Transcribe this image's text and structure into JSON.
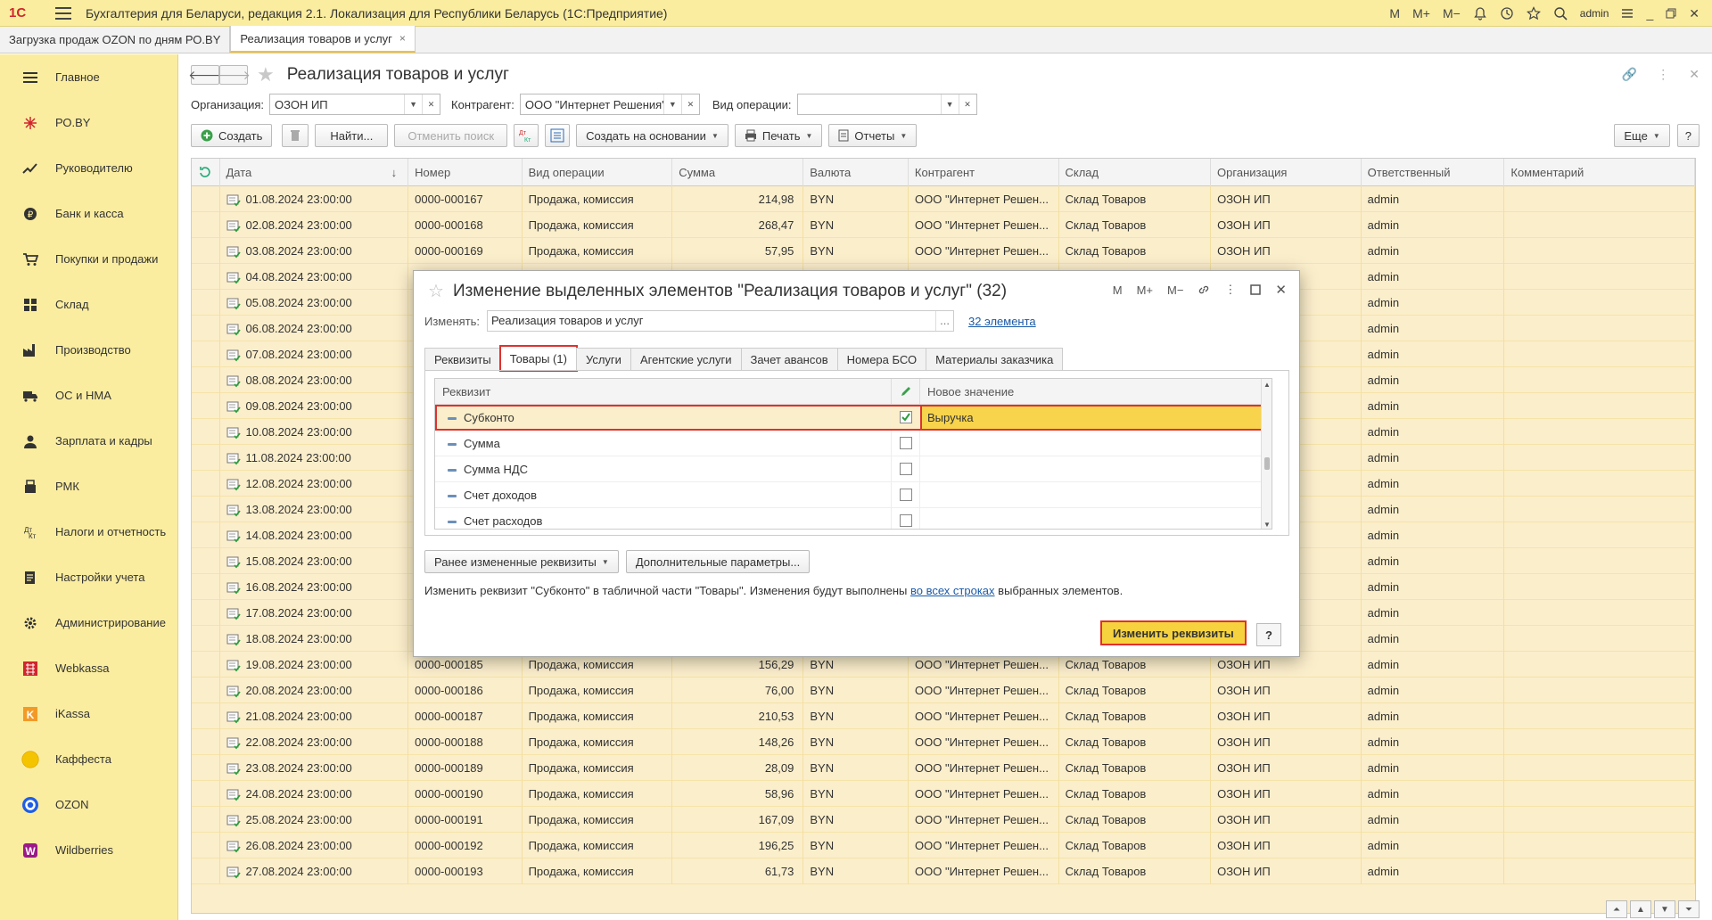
{
  "app": {
    "logo": "1С",
    "title": "Бухгалтерия для Беларуси, редакция 2.1. Локализация для Республики Беларусь   (1С:Предприятие)",
    "top_buttons": [
      "M",
      "M+",
      "M−"
    ],
    "user": "admin"
  },
  "tabs": [
    {
      "label": "Загрузка продаж OZON по дням РО.BY"
    },
    {
      "label": "Реализация товаров и услуг",
      "close": "×"
    }
  ],
  "sidebar": [
    {
      "label": "Главное",
      "icon": "menu-icon"
    },
    {
      "label": "РО.BY",
      "icon": "spark-icon"
    },
    {
      "label": "Руководителю",
      "icon": "trend-icon"
    },
    {
      "label": "Банк и касса",
      "icon": "coin-icon"
    },
    {
      "label": "Покупки и продажи",
      "icon": "cart-icon"
    },
    {
      "label": "Склад",
      "icon": "warehouse-icon"
    },
    {
      "label": "Производство",
      "icon": "factory-icon"
    },
    {
      "label": "ОС и НМА",
      "icon": "truck-icon"
    },
    {
      "label": "Зарплата и кадры",
      "icon": "person-icon"
    },
    {
      "label": "РМК",
      "icon": "register-icon"
    },
    {
      "label": "Налоги и отчетность",
      "icon": "tax-icon"
    },
    {
      "label": "Настройки учета",
      "icon": "settings-doc-icon"
    },
    {
      "label": "Администрирование",
      "icon": "gear-icon"
    },
    {
      "label": "Webkassa",
      "icon": "webkassa-icon"
    },
    {
      "label": "iKassa",
      "icon": "ikassa-icon"
    },
    {
      "label": "Каффеста",
      "icon": "kaffesta-icon"
    },
    {
      "label": "OZON",
      "icon": "ozon-icon"
    },
    {
      "label": "Wildberries",
      "icon": "wildberries-icon"
    }
  ],
  "page": {
    "title": "Реализация товаров и услуг",
    "filters": {
      "org_label": "Организация:",
      "org_value": "ОЗОН ИП",
      "contractor_label": "Контрагент:",
      "contractor_value": "ООО \"Интернет Решения\"",
      "optype_label": "Вид операции:",
      "optype_value": ""
    },
    "toolbar": {
      "create": "Создать",
      "find": "Найти...",
      "cancel_search": "Отменить поиск",
      "create_based": "Создать на основании",
      "print": "Печать",
      "reports": "Отчеты",
      "more": "Еще",
      "help": "?"
    }
  },
  "grid": {
    "columns": [
      "Дата",
      "Номер",
      "Вид операции",
      "Сумма",
      "Валюта",
      "Контрагент",
      "Склад",
      "Организация",
      "Ответственный",
      "Комментарий"
    ],
    "sort_indicator": "↓",
    "rows": [
      [
        "01.08.2024 23:00:00",
        "0000-000167",
        "Продажа, комиссия",
        "214,98",
        "BYN",
        "ООО \"Интернет Решен...",
        "Склад Товаров",
        "ОЗОН ИП",
        "admin",
        ""
      ],
      [
        "02.08.2024 23:00:00",
        "0000-000168",
        "Продажа, комиссия",
        "268,47",
        "BYN",
        "ООО \"Интернет Решен...",
        "Склад Товаров",
        "ОЗОН ИП",
        "admin",
        ""
      ],
      [
        "03.08.2024 23:00:00",
        "0000-000169",
        "Продажа, комиссия",
        "57,95",
        "BYN",
        "ООО \"Интернет Решен...",
        "Склад Товаров",
        "ОЗОН ИП",
        "admin",
        ""
      ],
      [
        "04.08.2024 23:00:00",
        "",
        "",
        "",
        "",
        "",
        "",
        "",
        "admin",
        ""
      ],
      [
        "05.08.2024 23:00:00",
        "",
        "",
        "",
        "",
        "",
        "",
        "",
        "admin",
        ""
      ],
      [
        "06.08.2024 23:00:00",
        "",
        "",
        "",
        "",
        "",
        "",
        "",
        "admin",
        ""
      ],
      [
        "07.08.2024 23:00:00",
        "",
        "",
        "",
        "",
        "",
        "",
        "",
        "admin",
        ""
      ],
      [
        "08.08.2024 23:00:00",
        "",
        "",
        "",
        "",
        "",
        "",
        "",
        "admin",
        ""
      ],
      [
        "09.08.2024 23:00:00",
        "",
        "",
        "",
        "",
        "",
        "",
        "",
        "admin",
        ""
      ],
      [
        "10.08.2024 23:00:00",
        "",
        "",
        "",
        "",
        "",
        "",
        "",
        "admin",
        ""
      ],
      [
        "11.08.2024 23:00:00",
        "",
        "",
        "",
        "",
        "",
        "",
        "",
        "admin",
        ""
      ],
      [
        "12.08.2024 23:00:00",
        "",
        "",
        "",
        "",
        "",
        "",
        "",
        "admin",
        ""
      ],
      [
        "13.08.2024 23:00:00",
        "",
        "",
        "",
        "",
        "",
        "",
        "",
        "admin",
        ""
      ],
      [
        "14.08.2024 23:00:00",
        "",
        "",
        "",
        "",
        "",
        "",
        "",
        "admin",
        ""
      ],
      [
        "15.08.2024 23:00:00",
        "",
        "",
        "",
        "",
        "",
        "",
        "",
        "admin",
        ""
      ],
      [
        "16.08.2024 23:00:00",
        "",
        "",
        "",
        "",
        "",
        "",
        "",
        "admin",
        ""
      ],
      [
        "17.08.2024 23:00:00",
        "",
        "",
        "",
        "",
        "",
        "",
        "",
        "admin",
        ""
      ],
      [
        "18.08.2024 23:00:00",
        "",
        "",
        "",
        "",
        "",
        "",
        "",
        "admin",
        ""
      ],
      [
        "19.08.2024 23:00:00",
        "0000-000185",
        "Продажа, комиссия",
        "156,29",
        "BYN",
        "ООО \"Интернет Решен...",
        "Склад Товаров",
        "ОЗОН ИП",
        "admin",
        ""
      ],
      [
        "20.08.2024 23:00:00",
        "0000-000186",
        "Продажа, комиссия",
        "76,00",
        "BYN",
        "ООО \"Интернет Решен...",
        "Склад Товаров",
        "ОЗОН ИП",
        "admin",
        ""
      ],
      [
        "21.08.2024 23:00:00",
        "0000-000187",
        "Продажа, комиссия",
        "210,53",
        "BYN",
        "ООО \"Интернет Решен...",
        "Склад Товаров",
        "ОЗОН ИП",
        "admin",
        ""
      ],
      [
        "22.08.2024 23:00:00",
        "0000-000188",
        "Продажа, комиссия",
        "148,26",
        "BYN",
        "ООО \"Интернет Решен...",
        "Склад Товаров",
        "ОЗОН ИП",
        "admin",
        ""
      ],
      [
        "23.08.2024 23:00:00",
        "0000-000189",
        "Продажа, комиссия",
        "28,09",
        "BYN",
        "ООО \"Интернет Решен...",
        "Склад Товаров",
        "ОЗОН ИП",
        "admin",
        ""
      ],
      [
        "24.08.2024 23:00:00",
        "0000-000190",
        "Продажа, комиссия",
        "58,96",
        "BYN",
        "ООО \"Интернет Решен...",
        "Склад Товаров",
        "ОЗОН ИП",
        "admin",
        ""
      ],
      [
        "25.08.2024 23:00:00",
        "0000-000191",
        "Продажа, комиссия",
        "167,09",
        "BYN",
        "ООО \"Интернет Решен...",
        "Склад Товаров",
        "ОЗОН ИП",
        "admin",
        ""
      ],
      [
        "26.08.2024 23:00:00",
        "0000-000192",
        "Продажа, комиссия",
        "196,25",
        "BYN",
        "ООО \"Интернет Решен...",
        "Склад Товаров",
        "ОЗОН ИП",
        "admin",
        ""
      ],
      [
        "27.08.2024 23:00:00",
        "0000-000193",
        "Продажа, комиссия",
        "61,73",
        "BYN",
        "ООО \"Интернет Решен...",
        "Склад Товаров",
        "ОЗОН ИП",
        "admin",
        ""
      ]
    ]
  },
  "modal": {
    "title": "Изменение выделенных элементов \"Реализация товаров и услуг\" (32)",
    "title_buttons": [
      "M",
      "M+",
      "M−"
    ],
    "change_label": "Изменять:",
    "change_value": "Реализация товаров и услуг",
    "change_dots": "...",
    "elements_link": "32 элемента",
    "tabs": [
      "Реквизиты",
      "Товары (1)",
      "Услуги",
      "Агентские услуги",
      "Зачет авансов",
      "Номера БСО",
      "Материалы заказчика"
    ],
    "active_tab": 1,
    "grid_columns": [
      "Реквизит",
      "Новое значение"
    ],
    "grid_rows": [
      {
        "name": "Субконто",
        "checked": true,
        "value": "Выручка"
      },
      {
        "name": "Сумма",
        "checked": false,
        "value": ""
      },
      {
        "name": "Сумма НДС",
        "checked": false,
        "value": ""
      },
      {
        "name": "Счет доходов",
        "checked": false,
        "value": ""
      },
      {
        "name": "Счет расходов",
        "checked": false,
        "value": ""
      }
    ],
    "prev_changed_btn": "Ранее измененные реквизиты",
    "extra_params_btn": "Дополнительные параметры...",
    "note_prefix": "Изменить реквизит \"Субконто\" в табличной части \"Товары\". Изменения будут выполнены ",
    "note_link": "во всех строках",
    "note_suffix": " выбранных элементов.",
    "ok_btn": "Изменить реквизиты",
    "help_btn": "?"
  },
  "colors": {
    "topbar": "#fbeda0",
    "row_bg": "#fbeecb",
    "highlight": "#e0312c",
    "accent_btn": "#f6d33e"
  }
}
